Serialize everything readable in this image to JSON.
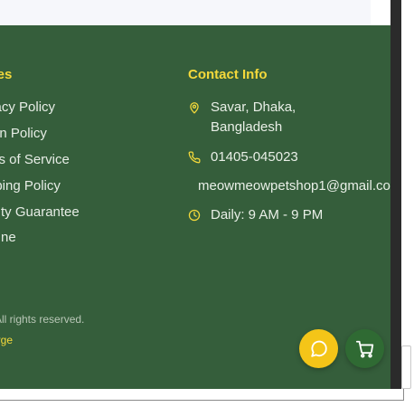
{
  "footer": {
    "policies_heading": "icies",
    "policies": [
      "vacy Policy",
      "urn Policy",
      "ms of Service",
      "pping Policy",
      "ality Guarantee",
      "pline"
    ],
    "contact_heading": "Contact Info",
    "contact": {
      "address_line1": "Savar, Dhaka,",
      "address_line2": "Bangladesh",
      "phone": "01405-045023",
      "email": "meowmeowpetshop1@gmail.com",
      "hours": "Daily: 9 AM - 9 PM"
    },
    "copyright": "All rights reserved.",
    "credit": "orge"
  },
  "colors": {
    "footer_bg": "#355e3b",
    "accent_yellow": "#f4d93b",
    "chat_button": "#f4c518",
    "cart_button": "#2f6a33"
  },
  "icons": {
    "address": "map-pin-icon",
    "phone": "phone-icon",
    "hours": "clock-icon",
    "chat": "chat-bubble-icon",
    "cart": "shopping-cart-icon"
  }
}
